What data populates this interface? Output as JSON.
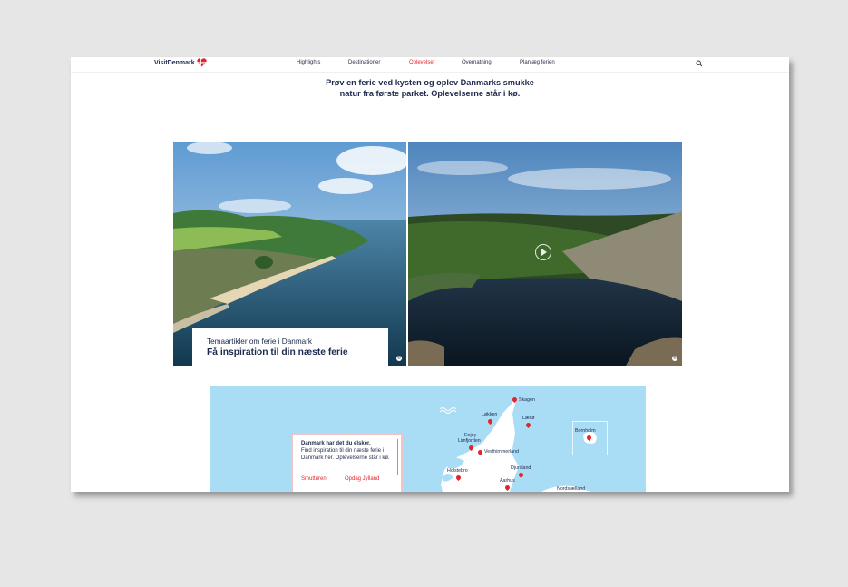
{
  "header": {
    "logo_text": "VisitDenmark",
    "nav": [
      {
        "label": "Highlights"
      },
      {
        "label": "Destinationer"
      },
      {
        "label": "Oplevelser"
      },
      {
        "label": "Overnatning"
      },
      {
        "label": "Planlæg ferien"
      }
    ],
    "active_nav": "Oplevelser",
    "search_icon": "search-icon"
  },
  "intro": {
    "line1": "Prøv en ferie ved kysten og oplev Danmarks smukke",
    "line2": "natur fra første parket. Oplevelserne står i kø."
  },
  "cards": {
    "left": {
      "subtitle": "Temaartikler om ferie i Danmark",
      "title": "Få inspiration til din næste ferie",
      "copyright": "©"
    },
    "right": {
      "play_icon": "play-icon",
      "copyright": "©"
    }
  },
  "map": {
    "labels": {
      "skagen": "Skagen",
      "loekken": "Løkken",
      "laesoe": "Læsø",
      "enjoy": "Enjoy",
      "limfjorden": "Limfjorden",
      "vesthimmerland": "Vesthimmerland",
      "holstebro": "Holstebro",
      "djursland": "Djursland",
      "aarhus": "Aarhus",
      "bornholm": "Bornholm",
      "nordsjaelland": "Nordsjælland"
    },
    "info": {
      "title": "Danmark har det du elsker.",
      "text": "Find inspiration til din næste ferie i Danmark her. Oplevelserne står i kø.",
      "link1": "Smutturen",
      "link2": "Opdag Jylland"
    }
  },
  "colors": {
    "accent": "#e3242b",
    "navy": "#1d2a4d",
    "sea": "#a9dcf5"
  }
}
